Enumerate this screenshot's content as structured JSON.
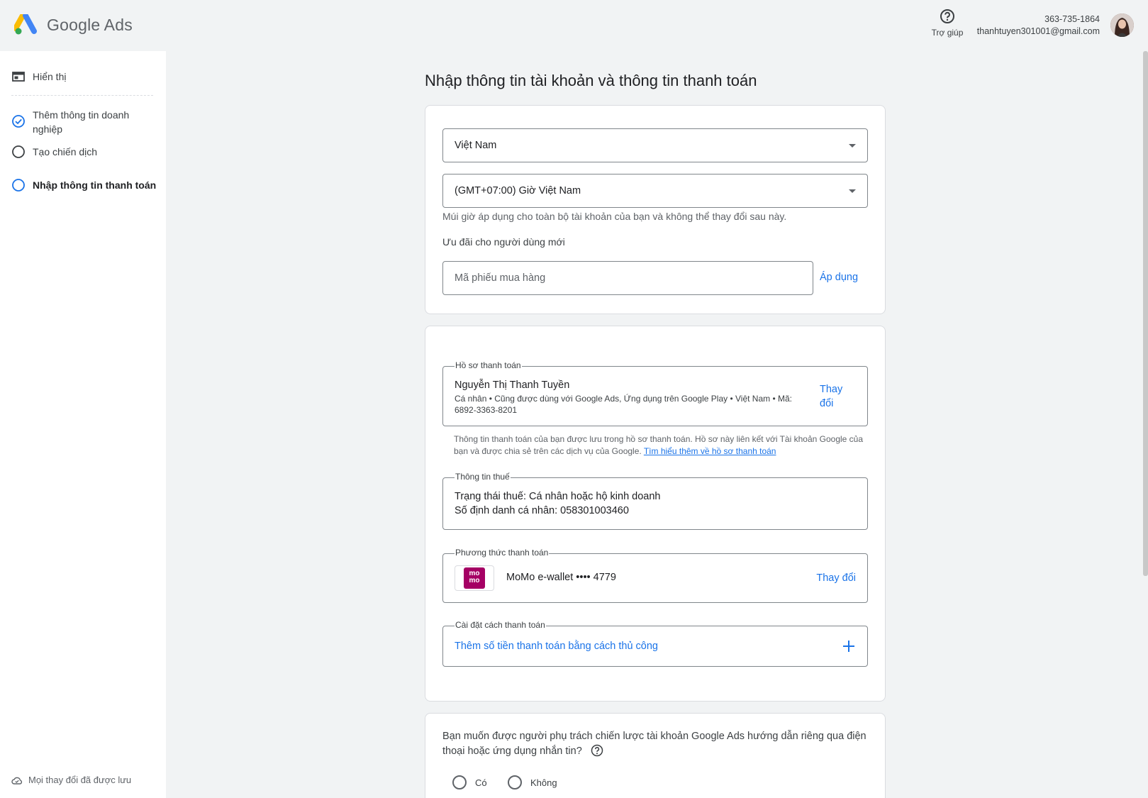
{
  "header": {
    "product_name": "Google Ads",
    "help_label": "Trợ giúp",
    "account_id": "363-735-1864",
    "account_email": "thanhtuyen301001@gmail.com"
  },
  "sidebar": {
    "steps": [
      {
        "label": "Hiển thị",
        "icon": "layout-icon",
        "state": "normal"
      },
      {
        "label": "Thêm thông tin doanh nghiệp",
        "icon": "check-circle-icon",
        "state": "done"
      },
      {
        "label": "Tạo chiến dịch",
        "icon": "circle-icon",
        "state": "pending"
      },
      {
        "label": "Nhập thông tin thanh toán",
        "icon": "circle-icon",
        "state": "active"
      }
    ],
    "saved_status": "Mọi thay đổi đã được lưu"
  },
  "main": {
    "title": "Nhập thông tin tài khoản và thông tin thanh toán",
    "country_select": "Việt Nam",
    "timezone_select": "(GMT+07:00) Giờ Việt Nam",
    "timezone_hint": "Múi giờ áp dụng cho toàn bộ tài khoản của bạn và không thể thay đổi sau này.",
    "promo_label": "Ưu đãi cho người dùng mới",
    "promo_placeholder": "Mã phiếu mua hàng",
    "apply_label": "Áp dụng",
    "billing_profile": {
      "legend": "Hồ sơ thanh toán",
      "name": "Nguyễn Thị Thanh Tuyền",
      "details": "Cá nhân • Cũng được dùng với Google Ads, Ứng dụng trên Google Play • Việt Nam • Mã: 6892-3363-8201",
      "change_label": "Thay đổi"
    },
    "billing_note": "Thông tin thanh toán của bạn được lưu trong hồ sơ thanh toán. Hồ sơ này liên kết với Tài khoản Google của bạn và được chia sẻ trên các dịch vụ của Google.",
    "billing_note_link": "Tìm hiểu thêm về hồ sơ thanh toán",
    "tax": {
      "legend": "Thông tin thuế",
      "status": "Trạng thái thuế: Cá nhân hoặc hộ kinh doanh",
      "id": "Số định danh cá nhân: 058301003460"
    },
    "payment_method": {
      "legend": "Phương thức thanh toán",
      "logo_text": "mo mo",
      "method": "MoMo e-wallet •••• 4779",
      "change_label": "Thay đổi"
    },
    "payment_setting": {
      "legend": "Cài đặt cách thanh toán",
      "action": "Thêm số tiền thanh toán bằng cách thủ công"
    },
    "advisor_question": "Bạn muốn được người phụ trách chiến lược tài khoản Google Ads hướng dẫn riêng qua điện thoại hoặc ứng dụng nhắn tin?",
    "options": [
      "Có",
      "Không"
    ]
  },
  "colors": {
    "accent": "#1a73e8",
    "momo": "#a50064",
    "background": "#f1f3f4"
  }
}
